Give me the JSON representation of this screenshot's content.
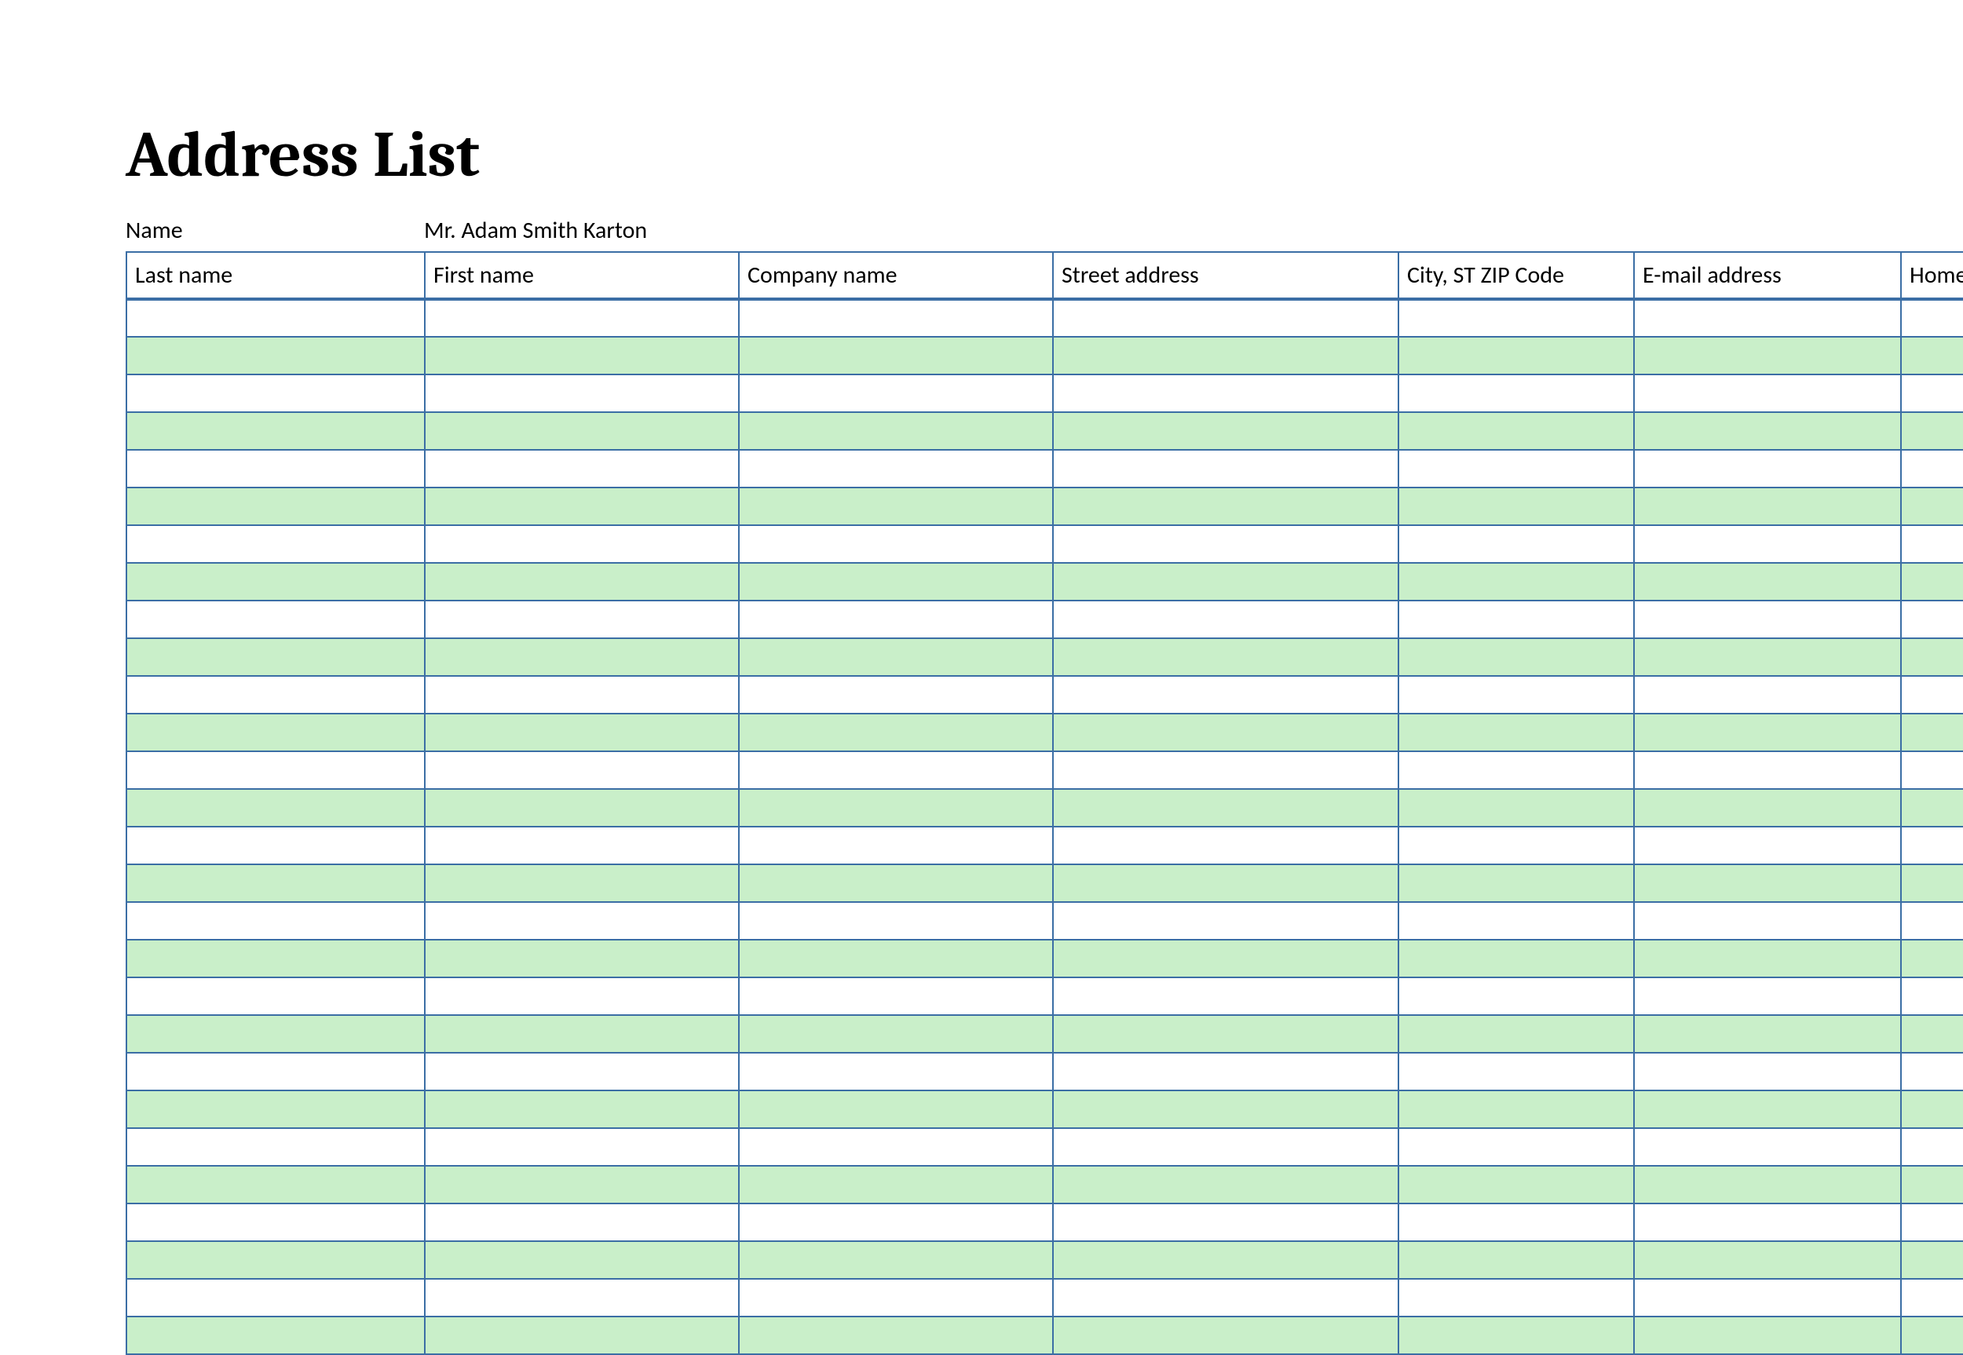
{
  "title": "Address List",
  "name_label": "Name",
  "name_value": "Mr. Adam Smith Karton",
  "columns": [
    "Last name",
    "First name",
    "Company name",
    "Street address",
    "City, ST  ZIP Code",
    "E-mail address",
    "Home"
  ],
  "row_count": 28,
  "rows": []
}
